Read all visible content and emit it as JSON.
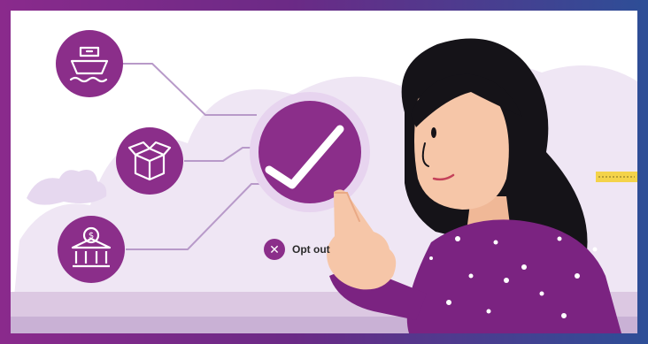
{
  "opt_out": {
    "label": "Opt out",
    "icon": "x-icon"
  },
  "icons": [
    "ship-icon",
    "box-icon",
    "bank-dollar-icon",
    "checkmark-icon"
  ],
  "colors": {
    "primary_purple": "#8b2e8a",
    "dark_purple": "#6b1f6e",
    "light_lavender": "#e9dff0",
    "frame_gradient_start": "#8a2a8c",
    "frame_gradient_end": "#2d4e97",
    "skin": "#f6c6a8",
    "hair": "#151318",
    "sleeve": "#7b2381"
  }
}
